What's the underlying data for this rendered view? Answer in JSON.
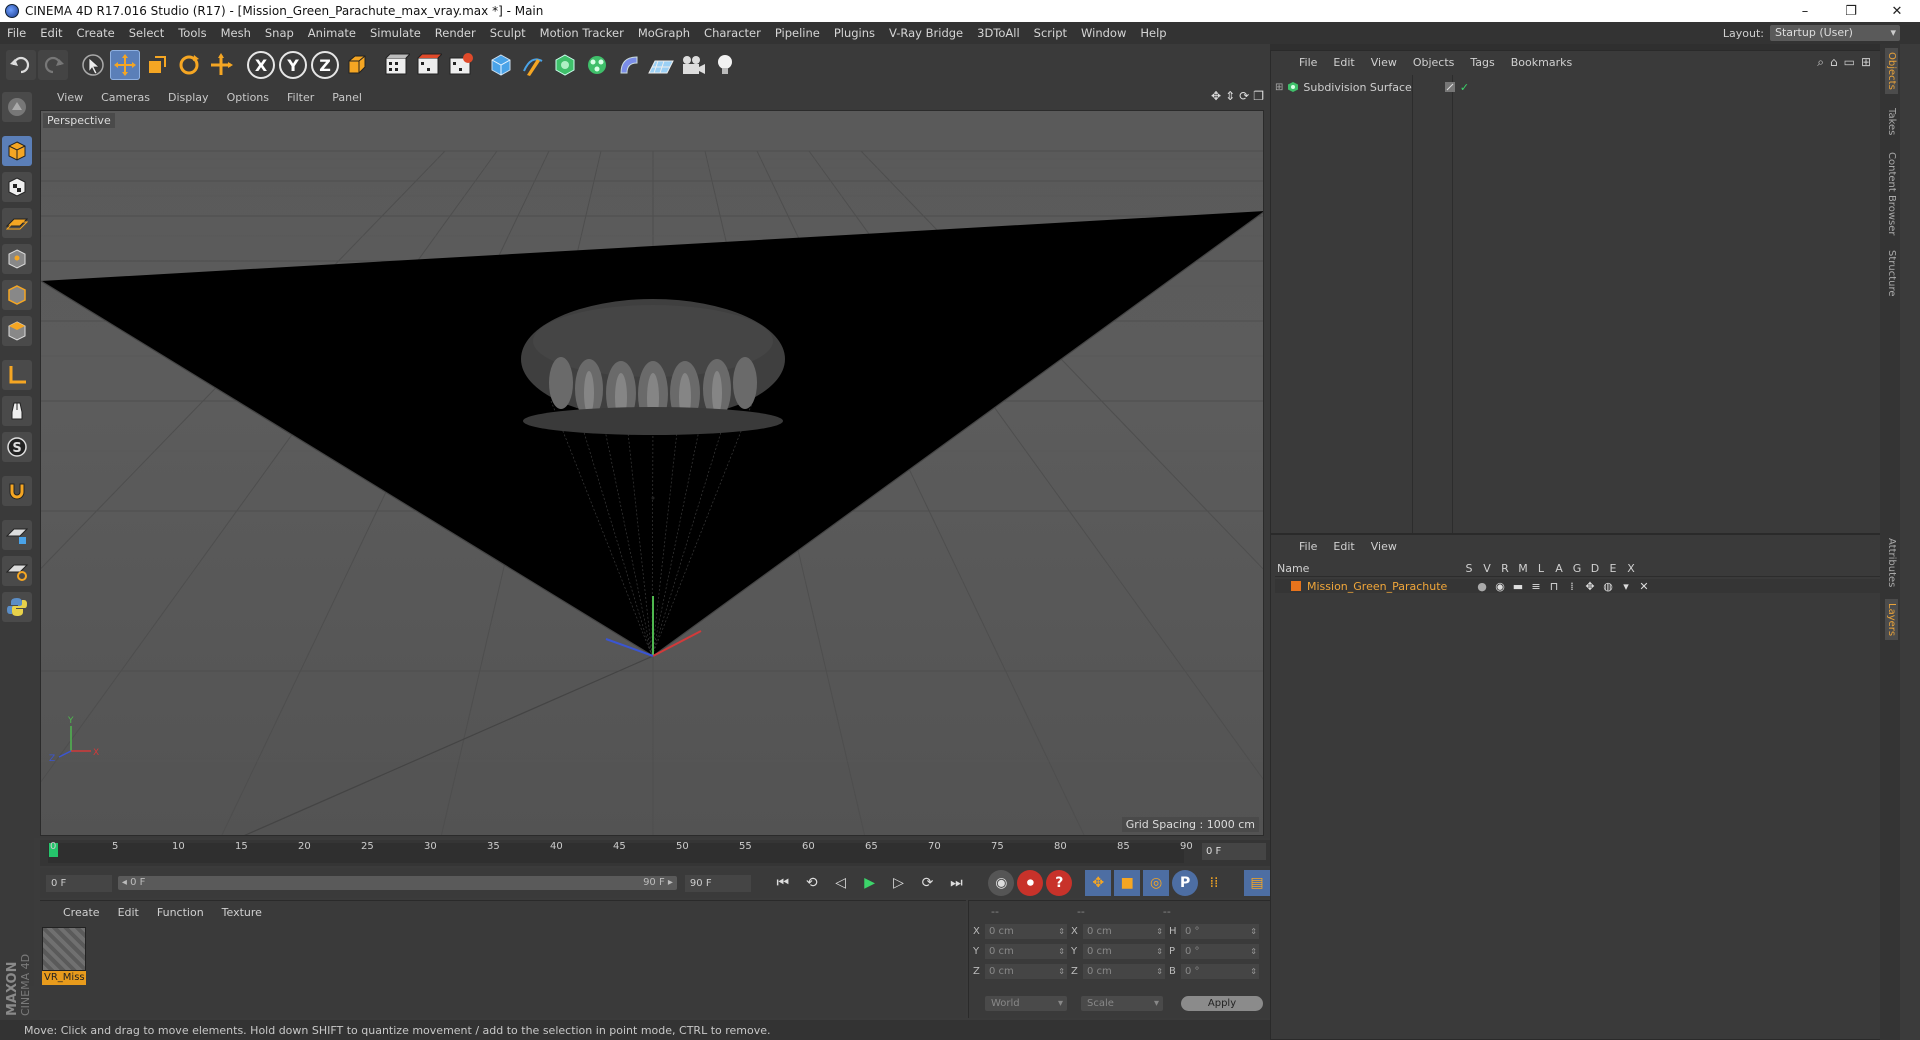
{
  "window": {
    "title": "CINEMA 4D R17.016 Studio (R17) - [Mission_Green_Parachute_max_vray.max *] - Main",
    "controls": [
      "–",
      "❐",
      "✕"
    ]
  },
  "menu": {
    "items": [
      "File",
      "Edit",
      "Create",
      "Select",
      "Tools",
      "Mesh",
      "Snap",
      "Animate",
      "Simulate",
      "Render",
      "Sculpt",
      "Motion Tracker",
      "MoGraph",
      "Character",
      "Pipeline",
      "Plugins",
      "V-Ray Bridge",
      "3DToAll",
      "Script",
      "Window",
      "Help"
    ],
    "layout_label": "Layout:",
    "layout_value": "Startup (User)"
  },
  "toolbar": {
    "axis_x": "X",
    "axis_y": "Y",
    "axis_z": "Z"
  },
  "viewport": {
    "menus": [
      "View",
      "Cameras",
      "Display",
      "Options",
      "Filter",
      "Panel"
    ],
    "camera_label": "Perspective",
    "grid_spacing": "Grid Spacing : 1000 cm",
    "axis_labels": {
      "x": "X",
      "y": "Y",
      "z": "Z"
    }
  },
  "timeline": {
    "ticks": [
      "0",
      "5",
      "10",
      "15",
      "20",
      "25",
      "30",
      "35",
      "40",
      "45",
      "50",
      "55",
      "60",
      "65",
      "70",
      "75",
      "80",
      "85",
      "90"
    ],
    "current_frame": "0 F"
  },
  "transport": {
    "start_field": "0 F",
    "range_start": "◂ 0 F",
    "range_end": "90 F ▸",
    "end_field": "90 F"
  },
  "material_manager": {
    "menus": [
      "Create",
      "Edit",
      "Function",
      "Texture"
    ],
    "material_name": "VR_Miss"
  },
  "branding": {
    "maxon": "MAXON",
    "cinema": "CINEMA 4D"
  },
  "coordinates": {
    "headers": [
      "--",
      "--",
      "--"
    ],
    "rows": [
      {
        "a": "X",
        "v1": "0 cm",
        "b": "X",
        "v2": "0 cm",
        "c": "H",
        "v3": "0 °"
      },
      {
        "a": "Y",
        "v1": "0 cm",
        "b": "Y",
        "v2": "0 cm",
        "c": "P",
        "v3": "0 °"
      },
      {
        "a": "Z",
        "v1": "0 cm",
        "b": "Z",
        "v2": "0 cm",
        "c": "B",
        "v3": "0 °"
      }
    ],
    "space": "World",
    "mode": "Scale",
    "apply": "Apply"
  },
  "status": {
    "text": "Move: Click and drag to move elements. Hold down SHIFT to quantize movement / add to the selection in point mode, CTRL to remove."
  },
  "objects_panel": {
    "menus": [
      "File",
      "Edit",
      "View",
      "Objects",
      "Tags",
      "Bookmarks"
    ],
    "object_name": "Subdivision Surface"
  },
  "layers_panel": {
    "menus": [
      "File",
      "Edit",
      "View"
    ],
    "name_header": "Name",
    "flags": [
      "S",
      "V",
      "R",
      "M",
      "L",
      "A",
      "G",
      "D",
      "E",
      "X"
    ],
    "layer_name": "Mission_Green_Parachute",
    "layer_color": "#e8741c"
  },
  "side_tabs": [
    "Objects",
    "Takes",
    "Content Browser",
    "Structure",
    "Attributes",
    "Layers"
  ],
  "colors": {
    "accent_selected": "#5b7fb8",
    "material_tag": "#e89b1c",
    "timeline_cursor": "#25c46b"
  }
}
